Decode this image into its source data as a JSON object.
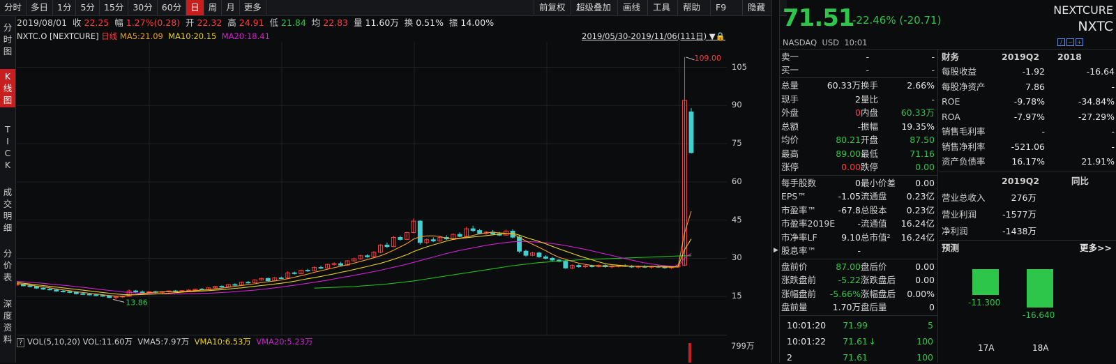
{
  "toolbar": {
    "left": [
      "分时",
      "多日",
      "1分",
      "5分",
      "15分",
      "30分",
      "60分",
      "日",
      "周",
      "月",
      "更多"
    ],
    "active": "日",
    "right": [
      "前复权",
      "超级叠加",
      "画线",
      "工具",
      "帮助",
      "F9",
      "隐藏"
    ]
  },
  "sidebar": [
    "分时图",
    "K线图",
    "TICK",
    "成交明细",
    "分价表",
    "深度资料"
  ],
  "sidebar_active": "K线图",
  "info": {
    "date": "2019/08/01",
    "close_label": "收",
    "close": "22.25",
    "amp_label": "幅",
    "amp": "1.27%(0.28)",
    "open_label": "开",
    "open": "22.32",
    "high_label": "高",
    "high": "24.91",
    "low_label": "低",
    "low": "21.84",
    "avg_label": "均",
    "avg": "22.83",
    "vol_label": "量",
    "vol": "11.60万",
    "turn_label": "换",
    "turn": "0.51%",
    "swing_label": "振",
    "swing": "14.00%"
  },
  "ma": {
    "symbol": "NXTC.O [NEXTCURE]",
    "period": "日线",
    "ma5": "MA5:21.09",
    "ma10": "MA10:20.15",
    "ma20": "MA20:18.41",
    "range": "2019/05/30-2019/11/06(111日)"
  },
  "colors": {
    "up": "#ff3b3b",
    "down": "#2ec64a",
    "ma5": "#e8e8e8",
    "ma10": "#e8d020",
    "ma20": "#d020d0",
    "ma60": "#20c020",
    "cyan": "#40d0d0"
  },
  "chart_data": {
    "type": "candlestick",
    "y_ticks": [
      105,
      90,
      75,
      60,
      45,
      30,
      15
    ],
    "ylim": [
      0,
      115
    ],
    "max_label": "109.00",
    "min_label": "13.86",
    "candles": [
      [
        19.5,
        20.1,
        19.2,
        19.8
      ],
      [
        19.8,
        19.9,
        19.0,
        19.2
      ],
      [
        19.2,
        19.6,
        18.6,
        18.9
      ],
      [
        18.9,
        19.0,
        18.0,
        18.3
      ],
      [
        18.3,
        18.6,
        17.6,
        17.9
      ],
      [
        17.9,
        18.3,
        17.4,
        17.6
      ],
      [
        17.6,
        17.9,
        16.9,
        17.1
      ],
      [
        17.1,
        17.6,
        16.6,
        16.9
      ],
      [
        16.9,
        17.4,
        16.3,
        16.6
      ],
      [
        16.6,
        16.9,
        15.8,
        16.1
      ],
      [
        16.1,
        16.6,
        15.6,
        15.9
      ],
      [
        15.9,
        16.3,
        15.4,
        15.7
      ],
      [
        15.7,
        16.1,
        15.1,
        15.4
      ],
      [
        15.4,
        15.9,
        14.9,
        15.2
      ],
      [
        15.2,
        15.6,
        14.4,
        14.6
      ],
      [
        14.6,
        15.1,
        13.86,
        14.9
      ],
      [
        14.9,
        15.4,
        14.4,
        15.1
      ],
      [
        15.1,
        17.8,
        14.9,
        17.2
      ],
      [
        17.2,
        17.6,
        16.4,
        16.8
      ],
      [
        16.8,
        17.4,
        16.2,
        16.6
      ],
      [
        16.6,
        17.2,
        16.1,
        16.9
      ],
      [
        16.9,
        17.3,
        16.3,
        16.7
      ],
      [
        16.7,
        17.1,
        16.2,
        16.9
      ],
      [
        16.9,
        17.4,
        16.5,
        17.2
      ],
      [
        17.2,
        17.6,
        16.7,
        17.0
      ],
      [
        17.0,
        17.5,
        16.6,
        17.3
      ],
      [
        17.3,
        17.8,
        16.9,
        17.5
      ],
      [
        17.5,
        18.1,
        17.2,
        17.9
      ],
      [
        17.9,
        18.3,
        17.4,
        17.7
      ],
      [
        17.7,
        18.6,
        17.5,
        18.4
      ],
      [
        18.4,
        19.2,
        18.1,
        19.0
      ],
      [
        19.0,
        19.4,
        18.5,
        18.8
      ],
      [
        18.8,
        19.9,
        18.6,
        19.7
      ],
      [
        19.7,
        20.2,
        19.2,
        19.5
      ],
      [
        19.5,
        20.9,
        19.3,
        20.6
      ],
      [
        20.6,
        21.1,
        20.1,
        20.4
      ],
      [
        20.4,
        21.8,
        20.2,
        21.5
      ],
      [
        21.5,
        22.4,
        21.2,
        22.1
      ],
      [
        22.1,
        22.4,
        20.9,
        21.2
      ],
      [
        21.2,
        22.6,
        21.0,
        22.3
      ],
      [
        22.3,
        22.8,
        21.84,
        22.25
      ],
      [
        22.25,
        24.91,
        21.8,
        24.3
      ],
      [
        24.3,
        24.8,
        23.6,
        24.0
      ],
      [
        24.0,
        25.6,
        23.8,
        25.3
      ],
      [
        25.3,
        25.9,
        24.7,
        25.1
      ],
      [
        25.1,
        26.8,
        24.9,
        26.4
      ],
      [
        26.4,
        27.1,
        25.8,
        26.2
      ],
      [
        26.2,
        27.9,
        26.0,
        27.6
      ],
      [
        27.6,
        28.4,
        27.1,
        27.9
      ],
      [
        27.9,
        28.6,
        27.0,
        27.3
      ],
      [
        27.3,
        29.3,
        27.1,
        29.0
      ],
      [
        29.0,
        30.2,
        28.6,
        29.8
      ],
      [
        29.8,
        31.4,
        29.4,
        31.0
      ],
      [
        31.0,
        31.6,
        30.2,
        30.6
      ],
      [
        30.6,
        32.8,
        30.4,
        32.4
      ],
      [
        32.4,
        35.6,
        32.0,
        35.2
      ],
      [
        35.2,
        36.2,
        34.1,
        34.6
      ],
      [
        34.6,
        38.8,
        34.4,
        38.2
      ],
      [
        38.2,
        38.9,
        36.9,
        37.4
      ],
      [
        37.4,
        40.4,
        37.1,
        40.1
      ],
      [
        40.1,
        45.6,
        39.8,
        44.6
      ],
      [
        44.6,
        45.0,
        35.4,
        36.2
      ],
      [
        36.2,
        37.8,
        35.6,
        37.3
      ],
      [
        37.3,
        38.2,
        36.4,
        36.8
      ],
      [
        36.8,
        38.6,
        36.5,
        38.2
      ],
      [
        38.2,
        39.1,
        37.2,
        37.6
      ],
      [
        37.6,
        39.8,
        37.3,
        39.4
      ],
      [
        39.4,
        40.2,
        38.2,
        38.6
      ],
      [
        38.6,
        42.4,
        38.4,
        41.6
      ],
      [
        41.6,
        42.8,
        40.4,
        40.9
      ],
      [
        40.9,
        41.6,
        39.4,
        39.8
      ],
      [
        39.8,
        40.8,
        39.2,
        40.3
      ],
      [
        40.3,
        41.1,
        39.3,
        39.6
      ],
      [
        39.6,
        40.4,
        38.7,
        39.1
      ],
      [
        39.1,
        41.2,
        38.9,
        40.7
      ],
      [
        40.7,
        41.4,
        37.8,
        38.3
      ],
      [
        38.3,
        39.0,
        32.1,
        32.8
      ],
      [
        32.8,
        33.4,
        30.6,
        31.2
      ],
      [
        31.2,
        32.6,
        30.8,
        32.1
      ],
      [
        32.1,
        32.6,
        30.2,
        30.6
      ],
      [
        30.6,
        31.2,
        29.6,
        30.0
      ],
      [
        30.0,
        30.6,
        28.8,
        29.3
      ],
      [
        29.3,
        29.8,
        28.4,
        28.8
      ],
      [
        28.8,
        29.4,
        25.9,
        26.2
      ],
      [
        26.2,
        27.6,
        25.8,
        27.2
      ],
      [
        27.2,
        27.8,
        26.3,
        26.7
      ],
      [
        26.7,
        27.4,
        26.2,
        27.0
      ],
      [
        27.0,
        27.5,
        26.4,
        26.8
      ],
      [
        26.8,
        27.6,
        26.4,
        27.2
      ],
      [
        27.2,
        27.7,
        26.3,
        26.7
      ],
      [
        26.7,
        27.3,
        26.1,
        26.9
      ],
      [
        26.9,
        27.4,
        26.4,
        27.1
      ],
      [
        27.1,
        27.7,
        26.6,
        26.9
      ],
      [
        26.9,
        27.4,
        26.2,
        26.6
      ],
      [
        26.6,
        27.2,
        26.0,
        26.8
      ],
      [
        26.8,
        27.3,
        26.2,
        26.5
      ],
      [
        26.5,
        27.1,
        25.9,
        26.8
      ],
      [
        26.8,
        27.4,
        26.3,
        26.6
      ],
      [
        26.6,
        27.2,
        25.9,
        26.3
      ],
      [
        26.3,
        26.9,
        25.8,
        26.6
      ],
      [
        26.6,
        27.6,
        26.3,
        27.3
      ],
      [
        27.3,
        109.0,
        26.9,
        92.0
      ],
      [
        87.5,
        89.0,
        71.16,
        71.51
      ]
    ],
    "ma5": [
      20.1,
      19.8,
      19.5,
      19.1,
      18.8,
      18.4,
      18.0,
      17.6,
      17.3,
      16.9,
      16.6,
      16.3,
      16.0,
      15.7,
      15.4,
      15.2,
      15.1,
      15.5,
      15.8,
      16.1,
      16.5,
      16.7,
      16.8,
      16.9,
      16.9,
      17.0,
      17.1,
      17.3,
      17.5,
      17.7,
      18.0,
      18.3,
      18.6,
      19.0,
      19.3,
      19.7,
      20.0,
      20.5,
      20.8,
      21.1,
      21.5,
      22.0,
      22.6,
      23.2,
      23.8,
      24.5,
      25.1,
      25.7,
      26.3,
      26.9,
      27.5,
      28.1,
      28.8,
      29.5,
      30.2,
      31.0,
      32.0,
      33.2,
      34.5,
      35.8,
      37.5,
      38.5,
      38.8,
      38.8,
      38.6,
      37.8,
      37.7,
      37.9,
      38.4,
      39.0,
      39.6,
      40.0,
      40.2,
      40.0,
      39.8,
      39.6,
      38.2,
      36.8,
      35.5,
      34.3,
      33.0,
      31.6,
      30.4,
      29.6,
      28.8,
      28.1,
      27.6,
      27.2,
      27.0,
      26.9,
      26.9,
      26.9,
      26.9,
      26.9,
      26.8,
      26.7,
      26.7,
      26.7,
      26.6,
      26.5,
      26.6,
      40.0,
      48.5
    ],
    "ma10": [
      20.5,
      20.2,
      19.9,
      19.6,
      19.3,
      19.0,
      18.7,
      18.4,
      18.1,
      17.8,
      17.5,
      17.2,
      16.9,
      16.6,
      16.3,
      16.0,
      15.8,
      15.7,
      15.7,
      15.8,
      15.9,
      16.0,
      16.1,
      16.3,
      16.5,
      16.7,
      16.9,
      17.0,
      17.1,
      17.3,
      17.5,
      17.7,
      17.9,
      18.2,
      18.4,
      18.7,
      19.0,
      19.3,
      19.6,
      19.9,
      20.2,
      20.6,
      21.0,
      21.5,
      22.0,
      22.4,
      22.9,
      23.4,
      23.9,
      24.5,
      25.0,
      25.6,
      26.2,
      26.8,
      27.4,
      28.0,
      28.8,
      29.6,
      30.5,
      31.4,
      32.6,
      33.6,
      34.5,
      35.3,
      36.0,
      36.8,
      37.4,
      37.8,
      38.1,
      38.4,
      38.6,
      38.9,
      39.2,
      39.5,
      39.7,
      39.8,
      39.1,
      38.2,
      37.4,
      36.6,
      35.7,
      34.7,
      33.7,
      32.8,
      31.9,
      31.0,
      30.2,
      29.4,
      28.6,
      27.9,
      27.5,
      27.3,
      27.1,
      26.9,
      26.9,
      26.8,
      26.8,
      26.8,
      26.8,
      26.7,
      26.7,
      33.4,
      37.6
    ],
    "ma20": [
      21.0,
      20.8,
      20.6,
      20.4,
      20.2,
      19.9,
      19.7,
      19.4,
      19.2,
      18.9,
      18.6,
      18.3,
      18.0,
      17.7,
      17.4,
      17.1,
      16.8,
      16.6,
      16.4,
      16.3,
      16.2,
      16.1,
      16.0,
      16.0,
      16.0,
      16.0,
      16.1,
      16.1,
      16.2,
      16.3,
      16.4,
      16.6,
      16.7,
      16.9,
      17.1,
      17.3,
      17.5,
      17.8,
      18.1,
      18.4,
      18.7,
      19.1,
      19.4,
      19.8,
      20.2,
      20.6,
      21.0,
      21.4,
      21.9,
      22.4,
      22.8,
      23.3,
      23.8,
      24.3,
      24.8,
      25.3,
      25.9,
      26.5,
      27.1,
      27.7,
      28.4,
      29.1,
      29.8,
      30.5,
      31.2,
      31.9,
      32.5,
      33.1,
      33.6,
      34.1,
      34.6,
      35.1,
      35.5,
      35.9,
      36.2,
      36.5,
      36.6,
      36.6,
      36.5,
      36.3,
      36.1,
      35.8,
      35.4,
      35.0,
      34.5,
      34.0,
      33.5,
      32.9,
      32.3,
      31.7,
      31.1,
      30.5,
      29.9,
      29.3,
      28.7,
      28.2,
      27.8,
      27.4,
      27.1,
      26.9,
      26.8,
      30.1,
      31.9
    ],
    "ma60": [
      null,
      null,
      null,
      null,
      null,
      null,
      null,
      null,
      null,
      null,
      null,
      null,
      null,
      null,
      null,
      null,
      null,
      null,
      null,
      null,
      null,
      null,
      null,
      null,
      null,
      null,
      null,
      null,
      null,
      null,
      null,
      null,
      null,
      null,
      null,
      null,
      null,
      null,
      null,
      null,
      null,
      null,
      null,
      null,
      null,
      18.3,
      18.4,
      18.5,
      18.6,
      18.7,
      18.8,
      18.9,
      19.1,
      19.3,
      19.5,
      19.7,
      19.9,
      20.2,
      20.5,
      20.8,
      21.1,
      21.5,
      21.9,
      22.3,
      22.7,
      23.1,
      23.5,
      23.9,
      24.3,
      24.7,
      25.1,
      25.5,
      25.9,
      26.3,
      26.7,
      27.1,
      27.4,
      27.7,
      28.0,
      28.3,
      28.5,
      28.7,
      28.9,
      29.1,
      29.2,
      29.4,
      29.5,
      29.6,
      29.7,
      29.8,
      29.9,
      30.0,
      30.1,
      30.2,
      30.3,
      30.4,
      30.5,
      30.6,
      30.7,
      30.8,
      30.9,
      31.0,
      31.0
    ],
    "volume_tick": "799万",
    "volume_legend": {
      "title": "VOL(5,10,20)",
      "vol": "VOL:11.60万",
      "vma5": "VMA5:7.97万",
      "vma10": "VMA10:6.53万",
      "vma20": "VMA20:5.23万"
    }
  },
  "quote": {
    "price": "71.51",
    "change": "-22.46% (-20.71)",
    "name": "NEXTCURE",
    "ticker": "NXTC",
    "market": "NASDAQ",
    "currency": "USD",
    "time": "10:01"
  },
  "order_book": [
    {
      "label": "卖一",
      "price": "-",
      "size": "-"
    },
    {
      "label": "买一",
      "price": "-",
      "size": "-"
    }
  ],
  "stats": [
    {
      "l1": "总量",
      "v1": "60.33万",
      "c1": "white",
      "l2": "换手",
      "v2": "2.66%",
      "c2": "white"
    },
    {
      "l1": "现手",
      "v1": "2",
      "c1": "white",
      "l2": "量比",
      "v2": "-",
      "c2": "white"
    },
    {
      "l1": "外盘",
      "v1": "0",
      "c1": "red",
      "l2": "内盘",
      "v2": "60.33万",
      "c2": "green"
    },
    {
      "l1": "总额",
      "v1": "-",
      "c1": "white",
      "l2": "振幅",
      "v2": "19.35%",
      "c2": "white"
    },
    {
      "l1": "均价",
      "v1": "80.21",
      "c1": "green",
      "l2": "开盘",
      "v2": "87.50",
      "c2": "green"
    },
    {
      "l1": "最高",
      "v1": "89.00",
      "c1": "green",
      "l2": "最低",
      "v2": "71.16",
      "c2": "green"
    },
    {
      "l1": "涨停",
      "v1": "0.00",
      "c1": "red",
      "l2": "跌停",
      "v2": "0.00",
      "c2": "green"
    }
  ],
  "stats2": [
    {
      "l1": "每手股数",
      "v1": "0",
      "l2": "最小价差",
      "v2": "0.00"
    },
    {
      "l1": "EPS™",
      "v1": "-1.05",
      "l2": "流通盘",
      "v2": "0.23亿"
    },
    {
      "l1": "市盈率™",
      "v1": "-67.8",
      "l2": "总股本",
      "v2": "0.23亿"
    },
    {
      "l1": "市盈率2019E",
      "v1": "-",
      "l2": "流通值",
      "v2": "16.24亿"
    },
    {
      "l1": "市净率LF",
      "v1": "9.10",
      "l2": "总市值²",
      "v2": "16.24亿"
    },
    {
      "l1": "股息率™",
      "v1": "-",
      "l2": "",
      "v2": ""
    }
  ],
  "premarket": [
    {
      "l1": "盘前价",
      "v1": "87.00",
      "c1": "green",
      "l2": "盘后价",
      "v2": "0.00",
      "c2": "white"
    },
    {
      "l1": "涨跌盘前",
      "v1": "-5.22",
      "c1": "green",
      "l2": "涨跌盘后",
      "v2": "0.00",
      "c2": "white"
    },
    {
      "l1": "涨幅盘前",
      "v1": "-5.66%",
      "c1": "green",
      "l2": "涨幅盘后",
      "v2": "0.00%",
      "c2": "white"
    },
    {
      "l1": "盘前量",
      "v1": "1.70万",
      "c1": "white",
      "l2": "盘后量",
      "v2": "0",
      "c2": "white"
    }
  ],
  "ticks": [
    {
      "time": "10:01:20",
      "price": "71.99",
      "arrow": "",
      "vol": "5"
    },
    {
      "time": "10:01:22",
      "price": "71.61",
      "arrow": "↓",
      "vol": "100"
    },
    {
      "time": "2",
      "price": "71.61",
      "arrow": "",
      "vol": "100"
    }
  ],
  "finance": {
    "title": "财务",
    "col1": "2019Q2",
    "col2": "2018",
    "rows": [
      {
        "l": "每股收益",
        "a": "-1.92",
        "b": "-16.64"
      },
      {
        "l": "每股净资产",
        "a": "7.86",
        "b": "-"
      },
      {
        "l": "ROE",
        "a": "-9.78%",
        "b": "-34.84%"
      },
      {
        "l": "ROA",
        "a": "-7.97%",
        "b": "-27.29%"
      },
      {
        "l": "销售毛利率",
        "a": "-",
        "b": "-"
      },
      {
        "l": "销售净利率",
        "a": "-521.06",
        "b": "-"
      },
      {
        "l": "资产负债率",
        "a": "16.17%",
        "b": "21.91%"
      }
    ],
    "col3": "2019Q2",
    "col4": "同比",
    "rows2": [
      {
        "l": "营业总收入",
        "a": "276万",
        "b": ""
      },
      {
        "l": "营业利润",
        "a": "-1577万",
        "b": ""
      },
      {
        "l": "净利润",
        "a": "-1438万",
        "b": ""
      }
    ]
  },
  "forecast": {
    "title": "预测",
    "more": "更多>>",
    "bars": [
      {
        "label": "17A",
        "value": -11.3,
        "text": "-11.300"
      },
      {
        "label": "18A",
        "value": -16.64,
        "text": "-16.640"
      }
    ]
  }
}
